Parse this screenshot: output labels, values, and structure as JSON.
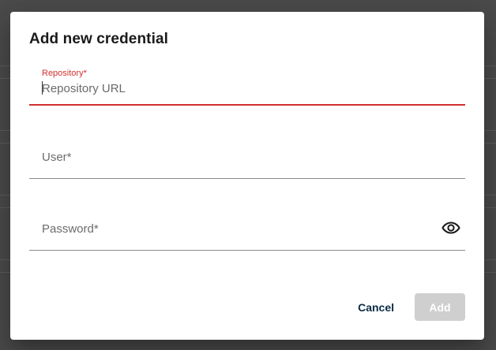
{
  "dialog": {
    "title": "Add new credential"
  },
  "fields": {
    "repository": {
      "label": "Repository*",
      "placeholder": "Repository URL",
      "value": ""
    },
    "user": {
      "placeholder": "User*",
      "value": ""
    },
    "password": {
      "placeholder": "Password*",
      "value": "",
      "toggle_icon": "eye-icon"
    }
  },
  "actions": {
    "cancel_label": "Cancel",
    "add_label": "Add"
  },
  "colors": {
    "error": "#d32f2f",
    "cancel_text": "#0b2b45",
    "add_disabled_bg": "#cfcfcf"
  }
}
